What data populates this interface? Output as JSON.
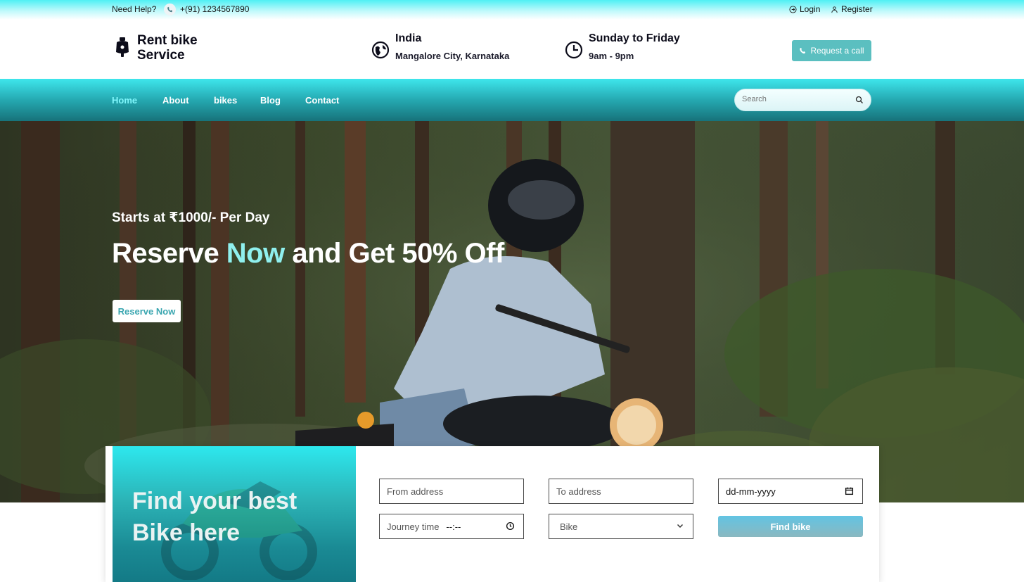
{
  "topbar": {
    "help": "Need Help?",
    "phone": "+(91) 1234567890",
    "login": "Login",
    "register": "Register"
  },
  "header": {
    "brand": "Rent bike Service",
    "location_title": "India",
    "location_sub": "Mangalore City, Karnataka",
    "hours_title": "Sunday to Friday",
    "hours_sub": "9am - 9pm",
    "request_call": "Request a call"
  },
  "nav": {
    "items": [
      "Home",
      "About",
      "bikes",
      "Blog",
      "Contact"
    ],
    "active": "Home",
    "search_placeholder": "Search"
  },
  "hero": {
    "subtitle": "Starts at ₹1000/- Per Day",
    "title_pre": "Reserve ",
    "title_highlight": "Now",
    "title_post": " and Get 50% Off",
    "cta": "Reserve Now"
  },
  "booking": {
    "promo": "Find your best Bike here",
    "from_placeholder": "From address",
    "to_placeholder": "To address",
    "date_placeholder": "dd-mm-yyyy",
    "time_label": "Journey time",
    "time_placeholder": "--:--",
    "bike_select": "Bike",
    "find_button": "Find bike"
  },
  "colors": {
    "accent": "#3ee6ec",
    "button": "#5bbfc0",
    "highlight": "#8ff0ee"
  }
}
